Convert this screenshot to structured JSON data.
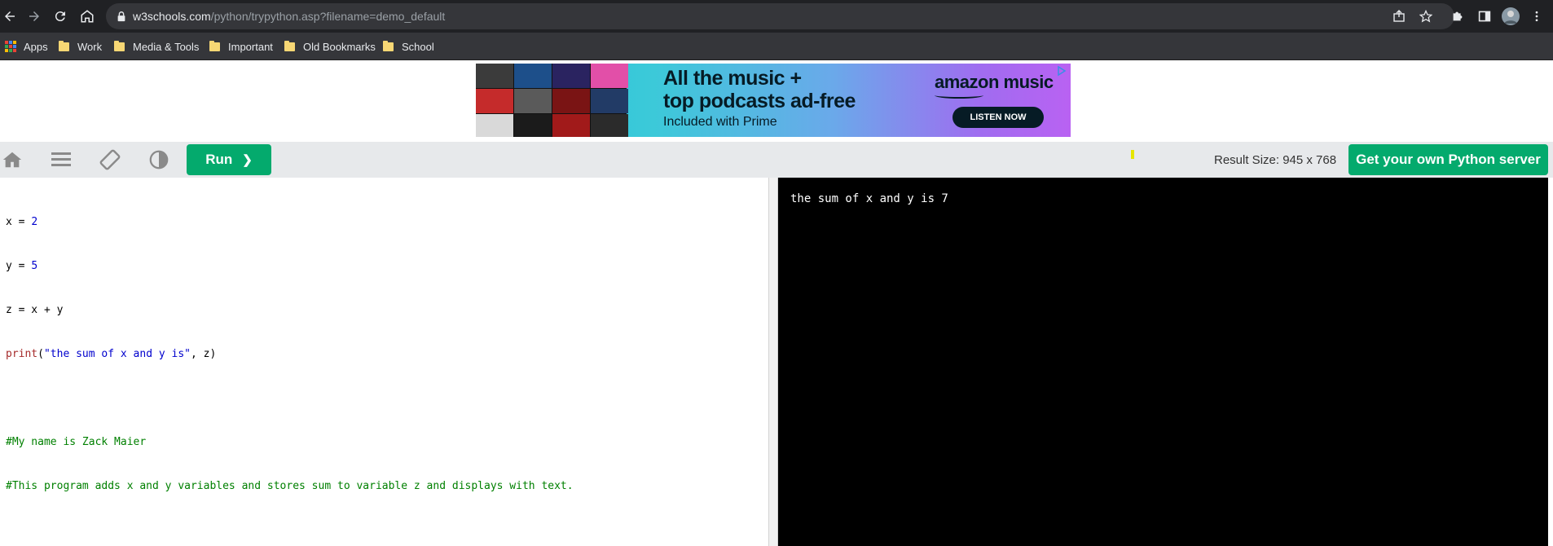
{
  "browser": {
    "url_host": "w3schools.com",
    "url_path": "/python/trypython.asp?filename=demo_default",
    "bookmarks": [
      {
        "label": "Apps"
      },
      {
        "label": "Work"
      },
      {
        "label": "Media & Tools"
      },
      {
        "label": "Important"
      },
      {
        "label": "Old Bookmarks"
      },
      {
        "label": "School"
      }
    ]
  },
  "ad": {
    "headline_line1": "All the music +",
    "headline_line2": "top podcasts ad-free",
    "subline": "Included with Prime",
    "brand": "amazon music",
    "cta": "LISTEN NOW"
  },
  "toolbar": {
    "run_label": "Run",
    "run_chevron": "❯",
    "result_size": "Result Size: 945 x 768",
    "server_button": "Get your own Python server"
  },
  "editor": {
    "lines": [
      {
        "a": "x = ",
        "b": "2"
      },
      {
        "a": "y = ",
        "b": "5"
      },
      {
        "a": "z = x + y"
      },
      {
        "fn": "print",
        "p1": "(",
        "str": "\"the sum of x and y is\"",
        "p2": ", z)"
      },
      {
        "a": ""
      },
      {
        "cmt": "#My name is Zack Maier"
      },
      {
        "cmt": "#This program adds x and y variables and stores sum to variable z and displays with text."
      }
    ]
  },
  "result": {
    "output": "the sum of x and y is 7"
  }
}
